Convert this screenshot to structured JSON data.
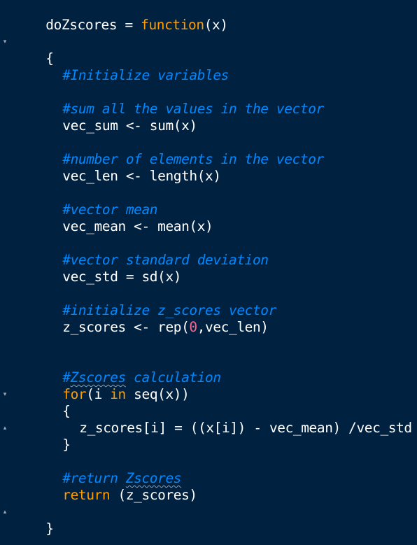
{
  "editor": {
    "theme_colors": {
      "background": "#002240",
      "text": "#ffffff",
      "keyword": "#ff9d00",
      "comment": "#0088ff",
      "number": "#ff628c"
    },
    "lines": {
      "l1": {
        "name": "doZscores",
        "assign": " = ",
        "fn": "function",
        "args": "(x)"
      },
      "l2": "{",
      "l3": "#Initialize variables",
      "l4": "#sum all the values in the vector",
      "l5": "vec_sum <- sum(x)",
      "l6": "#number of elements in the vector",
      "l7": "vec_len <- length(x)",
      "l8": "#vector mean",
      "l9": "vec_mean <- mean(x)",
      "l10": "#vector standard deviation",
      "l11": "vec_std = sd(x)",
      "l12": "#initialize z_scores vector",
      "l13": {
        "pre": "z_scores <- rep(",
        "num": "0",
        "post": ",vec_len)"
      },
      "l14": {
        "hash": "#",
        "word": "Zscores",
        "rest": " calculation"
      },
      "l15": {
        "kw1": "for",
        "mid": "(i ",
        "kw2": "in",
        "post": " seq(x))"
      },
      "l16": "{",
      "l17": "z_scores[i] = ((x[i]) - vec_mean) /vec_std",
      "l18": "}",
      "l19": {
        "hash": "#return ",
        "word": "Zscores"
      },
      "l20": {
        "kw": "return",
        "post": " (z_scores)"
      },
      "l21": "}"
    },
    "fold_markers": {
      "open": "▾",
      "close": "▴"
    }
  }
}
